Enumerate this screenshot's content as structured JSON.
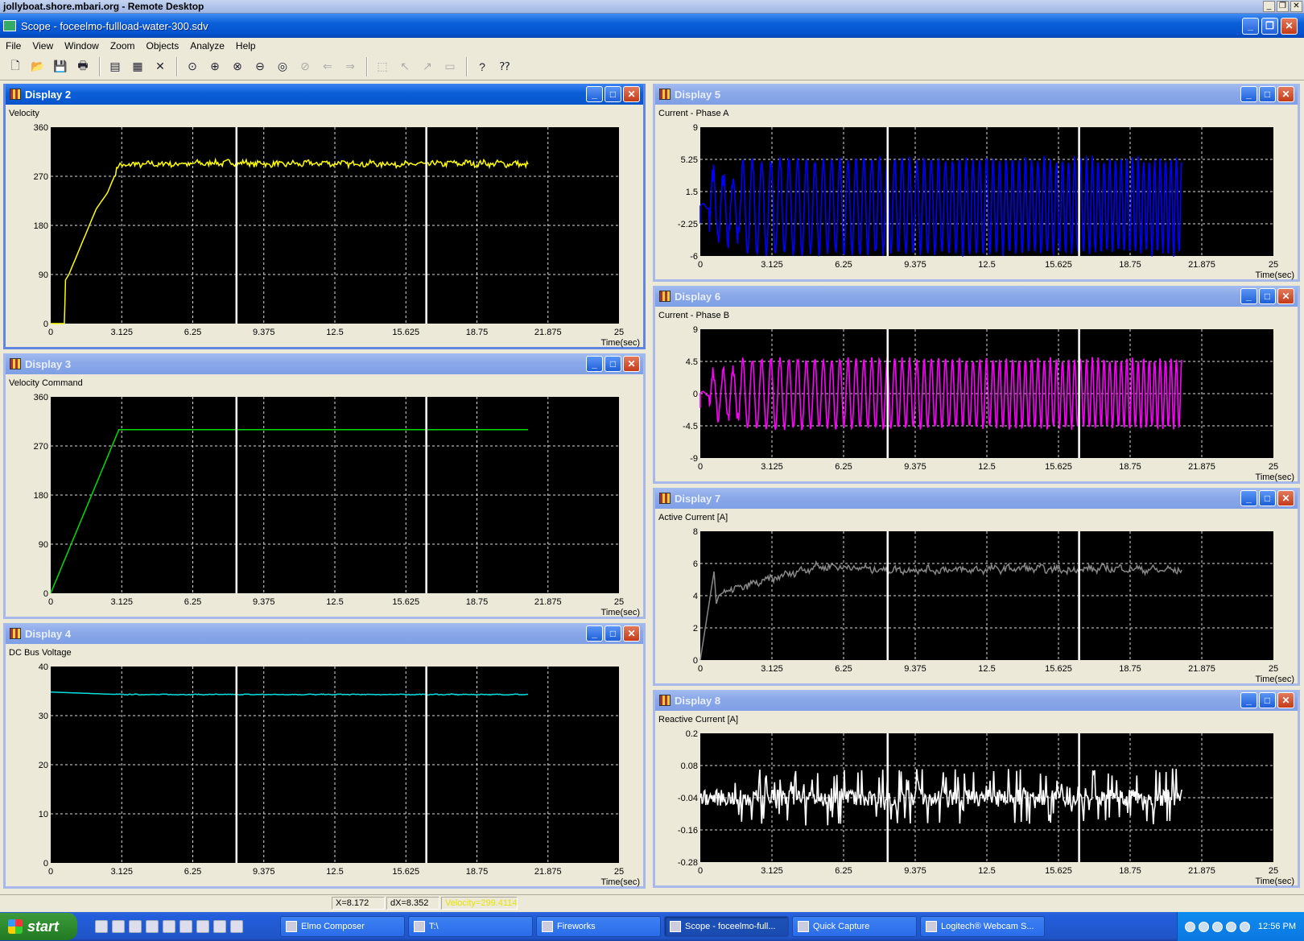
{
  "remote_title": "jollyboat.shore.mbari.org - Remote Desktop",
  "app_title": "Scope - foceelmo-fullload-water-300.sdv",
  "menu": [
    "File",
    "View",
    "Window",
    "Zoom",
    "Objects",
    "Analyze",
    "Help"
  ],
  "toolbar_icons": [
    "new-icon",
    "open-icon",
    "save-icon",
    "print-icon",
    "properties-icon",
    "export-icon",
    "delete-icon",
    "zoom-fit-icon",
    "zoom-in-icon",
    "zoom-x-icon",
    "zoom-out-icon",
    "zoom-1-icon",
    "zoom-prev-icon",
    "pan-left-icon",
    "pan-right-icon",
    "select-object-icon",
    "cursor1-icon",
    "cursor2-icon",
    "notes-icon",
    "help-icon",
    "context-help-icon"
  ],
  "x_ticks": [
    "0",
    "3.125",
    "6.25",
    "9.375",
    "12.5",
    "15.625",
    "18.75",
    "21.875",
    "25"
  ],
  "x_axis_label": "Time(sec)",
  "cursor_positions": [
    8.172,
    16.524
  ],
  "displays": [
    {
      "key": "d2",
      "title": "Display 2",
      "signal": "Velocity",
      "y_ticks": [
        "360",
        "270",
        "180",
        "90",
        "0"
      ],
      "ymin": 0,
      "ymax": 360,
      "color": "#ffff00",
      "active": true
    },
    {
      "key": "d3",
      "title": "Display 3",
      "signal": "Velocity Command",
      "y_ticks": [
        "360",
        "270",
        "180",
        "90",
        "0"
      ],
      "ymin": 0,
      "ymax": 360,
      "color": "#00dd00",
      "active": false
    },
    {
      "key": "d4",
      "title": "Display 4",
      "signal": "DC Bus Voltage",
      "y_ticks": [
        "40",
        "30",
        "20",
        "10",
        "0"
      ],
      "ymin": 0,
      "ymax": 40,
      "color": "#00e0e0",
      "active": false
    },
    {
      "key": "d5",
      "title": "Display 5",
      "signal": "Current - Phase A",
      "y_ticks": [
        "9",
        "5.25",
        "1.5",
        "-2.25",
        "-6"
      ],
      "ymin": -6,
      "ymax": 9,
      "color": "#0000ff",
      "active": false
    },
    {
      "key": "d6",
      "title": "Display 6",
      "signal": "Current - Phase B",
      "y_ticks": [
        "9",
        "4.5",
        "0",
        "-4.5",
        "-9"
      ],
      "ymin": -9,
      "ymax": 9,
      "color": "#ff00ff",
      "active": false
    },
    {
      "key": "d7",
      "title": "Display 7",
      "signal": "Active Current [A]",
      "y_ticks": [
        "8",
        "6",
        "4",
        "2",
        "0"
      ],
      "ymin": 0,
      "ymax": 8,
      "color": "#888888",
      "active": false
    },
    {
      "key": "d8",
      "title": "Display 8",
      "signal": "Reactive Current [A]",
      "y_ticks": [
        "0.2",
        "0.08",
        "-0.04",
        "-0.16",
        "-0.28"
      ],
      "ymin": -0.28,
      "ymax": 0.2,
      "color": "#ffffff",
      "active": false
    }
  ],
  "chart_data": [
    {
      "type": "line",
      "title": "Velocity",
      "xlabel": "Time(sec)",
      "xlim": [
        0,
        25
      ],
      "ylim": [
        0,
        360
      ],
      "series": [
        {
          "x": [
            0,
            0.6,
            0.65,
            0.8,
            1.0,
            1.5,
            2.0,
            2.5,
            2.9,
            3.0,
            4,
            6,
            8,
            10,
            12,
            14,
            16,
            18,
            20,
            21
          ],
          "y": [
            0,
            0,
            80,
            90,
            110,
            160,
            210,
            240,
            280,
            290,
            292,
            293,
            295,
            292,
            294,
            293,
            292,
            294,
            293,
            292
          ]
        }
      ]
    },
    {
      "type": "line",
      "title": "Velocity Command",
      "xlabel": "Time(sec)",
      "xlim": [
        0,
        25
      ],
      "ylim": [
        0,
        360
      ],
      "series": [
        {
          "x": [
            0,
            3.0,
            21
          ],
          "y": [
            0,
            300,
            300
          ]
        }
      ]
    },
    {
      "type": "line",
      "title": "DC Bus Voltage",
      "xlabel": "Time(sec)",
      "xlim": [
        0,
        25
      ],
      "ylim": [
        0,
        40
      ],
      "series": [
        {
          "x": [
            0,
            3,
            21
          ],
          "y": [
            34.8,
            34.3,
            34.3
          ]
        }
      ]
    },
    {
      "type": "line",
      "title": "Current - Phase A",
      "xlabel": "Time(sec)",
      "xlim": [
        0,
        25
      ],
      "ylim": [
        -6,
        9
      ],
      "series": [
        {
          "x": [
            0.5,
            21
          ],
          "y": [
            -5.5,
            5.5
          ]
        }
      ]
    },
    {
      "type": "line",
      "title": "Current - Phase B",
      "xlabel": "Time(sec)",
      "xlim": [
        0,
        25
      ],
      "ylim": [
        -9,
        9
      ],
      "series": [
        {
          "x": [
            0.5,
            21
          ],
          "y": [
            -5,
            5
          ]
        }
      ]
    },
    {
      "type": "line",
      "title": "Active Current [A]",
      "xlabel": "Time(sec)",
      "xlim": [
        0,
        25
      ],
      "ylim": [
        0,
        8
      ],
      "series": [
        {
          "x": [
            0,
            0.6,
            0.7,
            0.8,
            1.0,
            2,
            3,
            4,
            5,
            6,
            8,
            10,
            12,
            14,
            16,
            18,
            20,
            21
          ],
          "y": [
            0,
            5.5,
            3.5,
            4,
            4.2,
            4.6,
            5.0,
            5.4,
            5.8,
            5.8,
            5.6,
            5.6,
            5.6,
            5.7,
            5.6,
            5.7,
            5.6,
            5.6
          ]
        }
      ]
    },
    {
      "type": "line",
      "title": "Reactive Current [A]",
      "xlabel": "Time(sec)",
      "xlim": [
        0,
        25
      ],
      "ylim": [
        -0.28,
        0.2
      ],
      "series": [
        {
          "x": [
            0,
            21
          ],
          "y": [
            -0.04,
            -0.04
          ]
        }
      ]
    }
  ],
  "status": {
    "x": "X=8.172",
    "dx": "dX=8.352",
    "val": "Velocity=299.4114"
  },
  "taskbar": {
    "start": "start",
    "tasks": [
      {
        "label": "Elmo Composer"
      },
      {
        "label": "T:\\"
      },
      {
        "label": "Fireworks"
      },
      {
        "label": "Scope - foceelmo-full..."
      },
      {
        "label": "Quick Capture"
      },
      {
        "label": "Logitech® Webcam S..."
      }
    ],
    "clock": "12:56 PM"
  }
}
